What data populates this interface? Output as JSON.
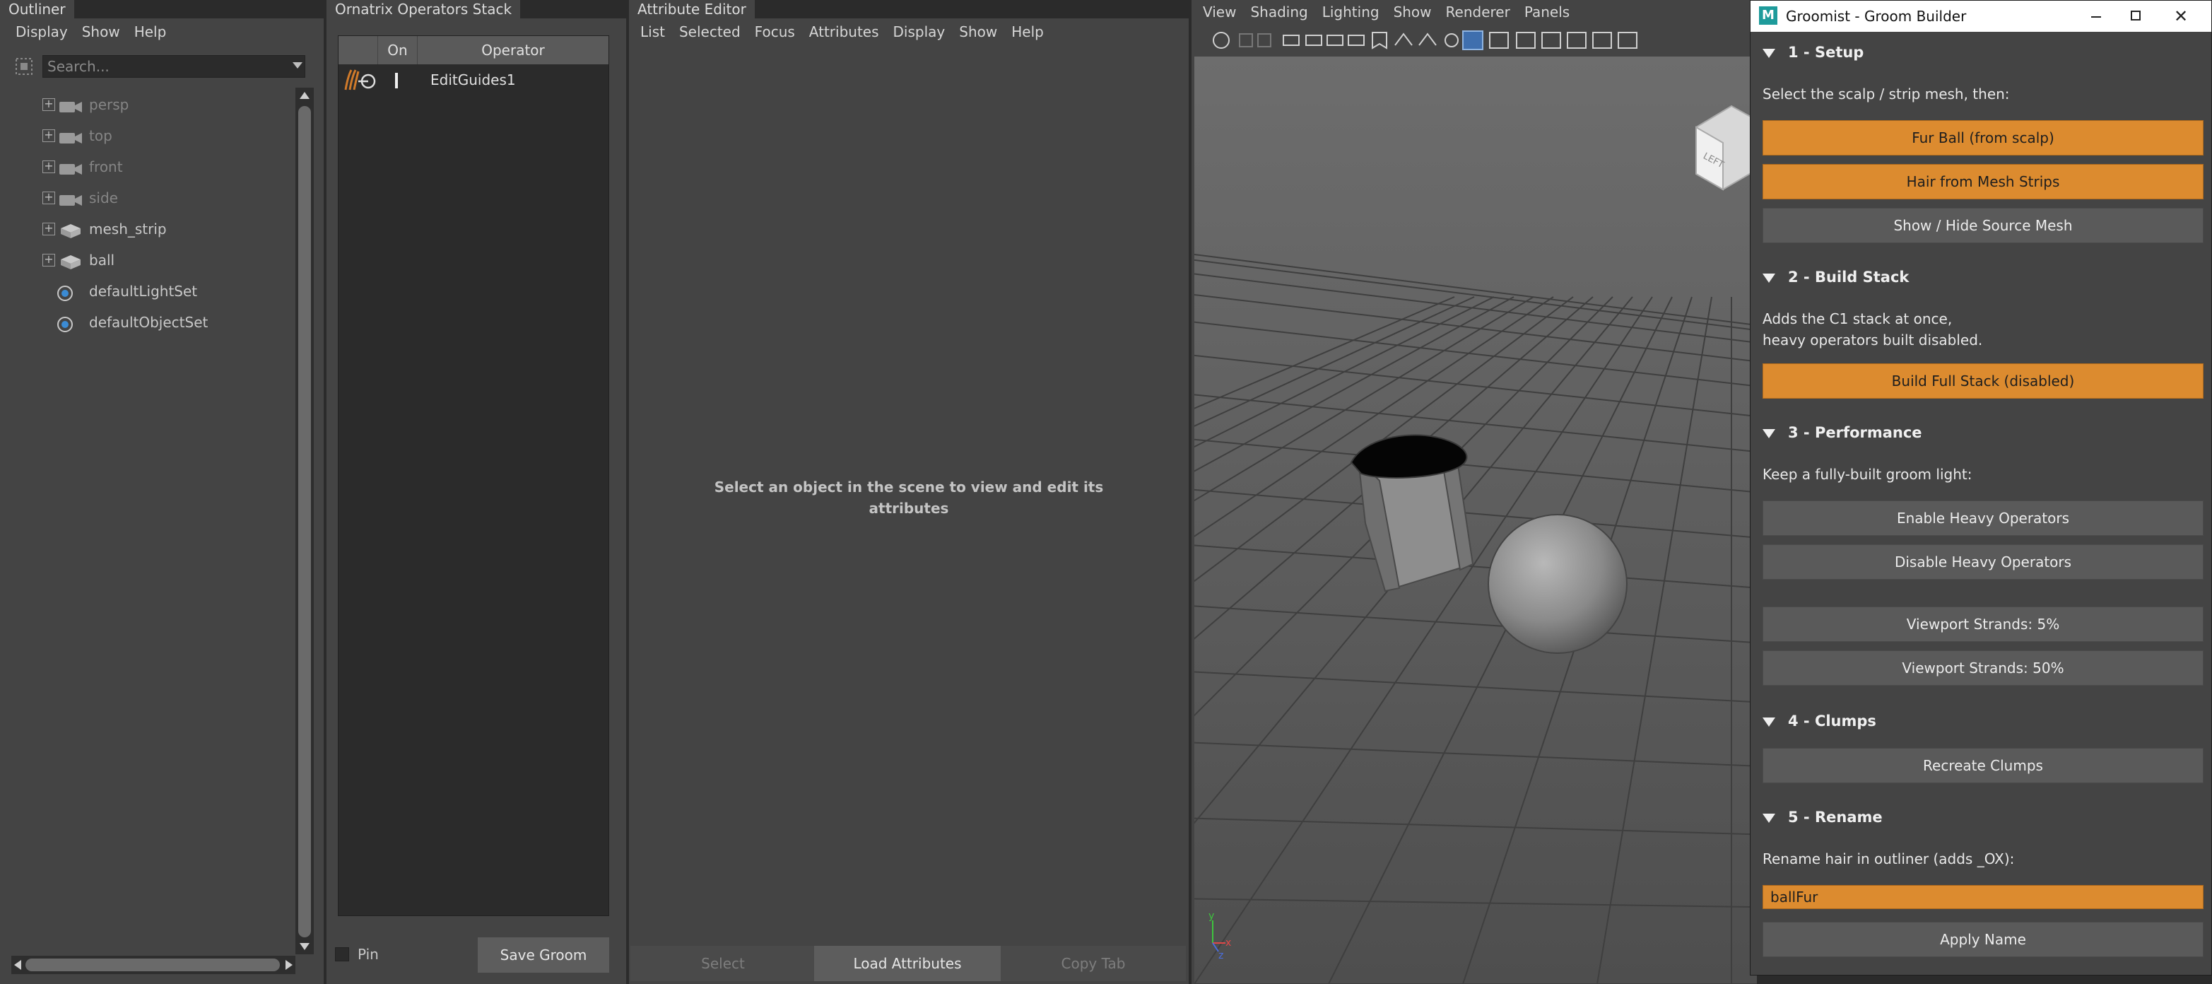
{
  "outliner": {
    "tab": "Outliner",
    "menu": [
      "Display",
      "Show",
      "Help"
    ],
    "search_placeholder": "Search...",
    "items": [
      {
        "label": "persp",
        "icon": "camera-icon",
        "expander": "+",
        "dim": true
      },
      {
        "label": "top",
        "icon": "camera-icon",
        "expander": "+",
        "dim": true
      },
      {
        "label": "front",
        "icon": "camera-icon",
        "expander": "+",
        "dim": true
      },
      {
        "label": "side",
        "icon": "camera-icon",
        "expander": "+",
        "dim": true
      },
      {
        "label": "mesh_strip",
        "icon": "mesh-icon",
        "expander": "+",
        "dim": false
      },
      {
        "label": "ball",
        "icon": "mesh-icon",
        "expander": "+",
        "dim": false
      },
      {
        "label": "defaultLightSet",
        "icon": "set-icon",
        "expander": "",
        "dim": false
      },
      {
        "label": "defaultObjectSet",
        "icon": "set-icon",
        "expander": "",
        "dim": false
      }
    ]
  },
  "ornatrix": {
    "tab": "Ornatrix Operators Stack",
    "col_on": "On",
    "col_operator": "Operator",
    "operators": [
      {
        "name": "EditGuides1",
        "icon": "guides-icon"
      }
    ],
    "pin_label": "Pin",
    "save_label": "Save Groom"
  },
  "attr_editor": {
    "tab": "Attribute Editor",
    "menu": [
      "List",
      "Selected",
      "Focus",
      "Attributes",
      "Display",
      "Show",
      "Help"
    ],
    "message_line1": "Select an object in the scene to view and edit its",
    "message_line2": "attributes",
    "btn_select": "Select",
    "btn_load": "Load Attributes",
    "btn_copy": "Copy Tab"
  },
  "viewport": {
    "menu": [
      "View",
      "Shading",
      "Lighting",
      "Show",
      "Renderer",
      "Panels"
    ],
    "viewcube_label": "LEFT",
    "axis_labels": {
      "x": "x",
      "y": "y",
      "z": "z"
    }
  },
  "groomist": {
    "title": "Groomist - Groom Builder",
    "app_icon_letter": "M",
    "sections": {
      "setup": "1 - Setup",
      "build": "2 - Build Stack",
      "performance": "3 - Performance",
      "clumps": "4 - Clumps",
      "rename": "5 - Rename"
    },
    "setup_text": "Select the scalp / strip mesh, then:",
    "btn_fur_ball": "Fur Ball (from scalp)",
    "btn_hair_strips": "Hair from Mesh Strips",
    "btn_show_hide": "Show / Hide Source Mesh",
    "build_text1": "Adds the C1 stack at once,",
    "build_text2": "heavy operators built disabled.",
    "btn_build_full": "Build Full Stack (disabled)",
    "perf_text": "Keep a fully-built groom light:",
    "btn_enable_heavy": "Enable Heavy Operators",
    "btn_disable_heavy": "Disable Heavy Operators",
    "btn_strands_5": "Viewport Strands: 5%",
    "btn_strands_50": "Viewport Strands: 50%",
    "btn_recreate_clumps": "Recreate Clumps",
    "rename_text": "Rename hair in outliner (adds _OX):",
    "rename_value": "ballFur",
    "btn_apply_name": "Apply Name"
  },
  "colors": {
    "accent_orange": "#dc8b2f",
    "panel_bg": "#444444",
    "viewport_bg": "#626262"
  }
}
